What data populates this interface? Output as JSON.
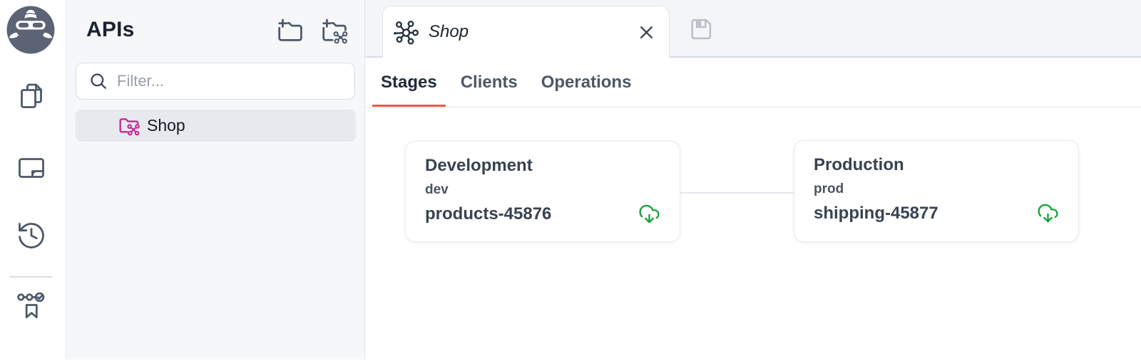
{
  "sidebar": {
    "title": "APIs",
    "filter_placeholder": "Filter...",
    "items": [
      {
        "label": "Shop",
        "selected": true
      }
    ]
  },
  "editor": {
    "tab": {
      "label": "Shop",
      "dirty": true
    },
    "subtabs": [
      {
        "label": "Stages",
        "active": true
      },
      {
        "label": "Clients",
        "active": false
      },
      {
        "label": "Operations",
        "active": false
      }
    ],
    "stages": {
      "cards": [
        {
          "title": "Development",
          "stage_id": "dev",
          "deployment": "products-45876"
        },
        {
          "title": "Production",
          "stage_id": "prod",
          "deployment": "shipping-45877"
        }
      ]
    }
  },
  "icons": {
    "rail": [
      "gorilla-logo",
      "copy-icon",
      "picture-in-picture-icon",
      "history-icon",
      "checks-bookmark-icon"
    ],
    "sidebar": [
      "new-folder-icon",
      "new-api-folder-icon",
      "search-icon",
      "api-folder-icon"
    ],
    "editor": [
      "api-network-icon",
      "close-icon",
      "save-floppy-icon",
      "cloud-download-icon"
    ]
  },
  "colors": {
    "active_subtab_underline": "#ee5b4c",
    "api_folder_pink": "#c32b96",
    "deploy_green": "#1aa53d",
    "sidebar_bg": "#f6f7f9",
    "topbar_bg": "#f4f5f8"
  }
}
